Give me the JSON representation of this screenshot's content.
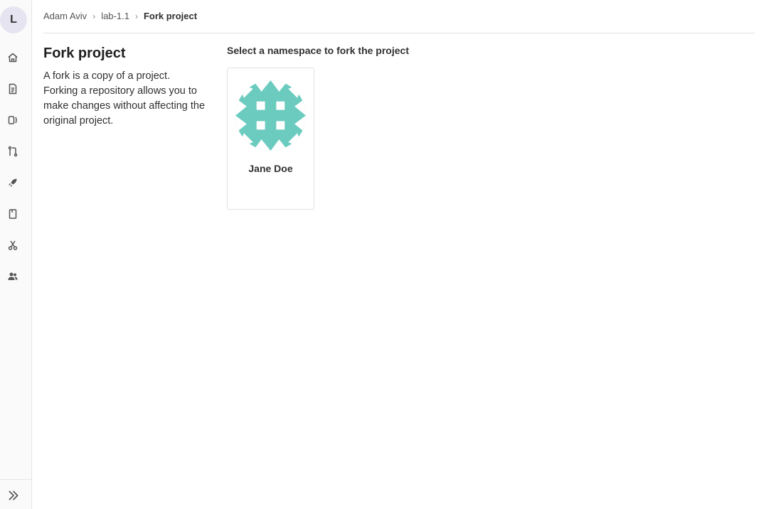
{
  "sidebar": {
    "project_initial": "L",
    "items": [
      {
        "name": "home",
        "icon": "home-icon"
      },
      {
        "name": "repository",
        "icon": "document-icon"
      },
      {
        "name": "issues",
        "icon": "issues-icon"
      },
      {
        "name": "merge-requests",
        "icon": "merge-request-icon"
      },
      {
        "name": "deployments",
        "icon": "rocket-icon"
      },
      {
        "name": "wiki",
        "icon": "book-icon"
      },
      {
        "name": "snippets",
        "icon": "scissors-icon"
      },
      {
        "name": "members",
        "icon": "users-icon"
      }
    ],
    "collapse_icon": "double-chevron-right-icon"
  },
  "breadcrumb": {
    "items": [
      "Adam Aviv",
      "lab-1.1",
      "Fork project"
    ]
  },
  "page": {
    "title": "Fork project",
    "description": "A fork is a copy of a project. Forking a repository allows you to make changes without affecting the original project."
  },
  "namespaces": {
    "title": "Select a namespace to fork the project",
    "items": [
      {
        "name": "Jane Doe",
        "avatar_color": "#6ccbbf"
      }
    ]
  },
  "colors": {
    "avatar_teal": "#6ccbbf",
    "sidebar_bg": "#fafafa",
    "project_avatar_bg": "#e7e4f2"
  }
}
